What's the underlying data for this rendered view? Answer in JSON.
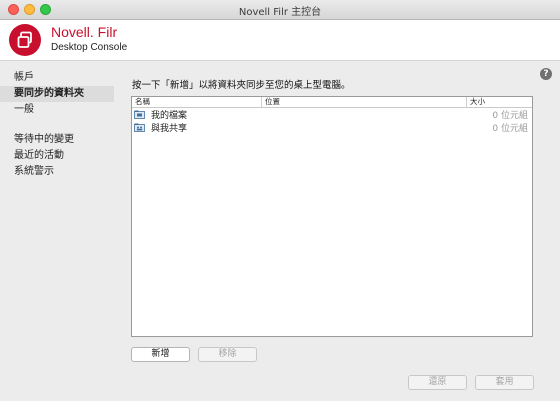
{
  "window": {
    "title": "Novell Filr 主控台"
  },
  "header": {
    "brand": "Novell. Filr",
    "subtitle": "Desktop Console"
  },
  "sidebar": {
    "items": [
      {
        "label": "帳戶",
        "active": false
      },
      {
        "label": "要同步的資料夾",
        "active": true
      },
      {
        "label": "一般",
        "active": false
      },
      {
        "label": "等待中的變更",
        "active": false
      },
      {
        "label": "最近的活動",
        "active": false
      },
      {
        "label": "系統警示",
        "active": false
      }
    ]
  },
  "help": {
    "icon": "question-icon",
    "label": "?"
  },
  "main": {
    "instruction": "按一下「新增」以將資料夾同步至您的桌上型電腦。",
    "columns": {
      "name": "名稱",
      "location": "位置",
      "size": "大小"
    },
    "rows": [
      {
        "name": "我的檔案",
        "location": "",
        "size": "0 位元組",
        "icon": "my-files-folder-icon"
      },
      {
        "name": "與我共享",
        "location": "",
        "size": "0 位元組",
        "icon": "shared-folder-icon"
      }
    ],
    "buttons": {
      "add": "新增",
      "remove": "移除"
    }
  },
  "footer": {
    "revert": "還原",
    "apply": "套用"
  },
  "colors": {
    "brand_red": "#c8102e",
    "selected_nav": "#dcdcdc"
  }
}
